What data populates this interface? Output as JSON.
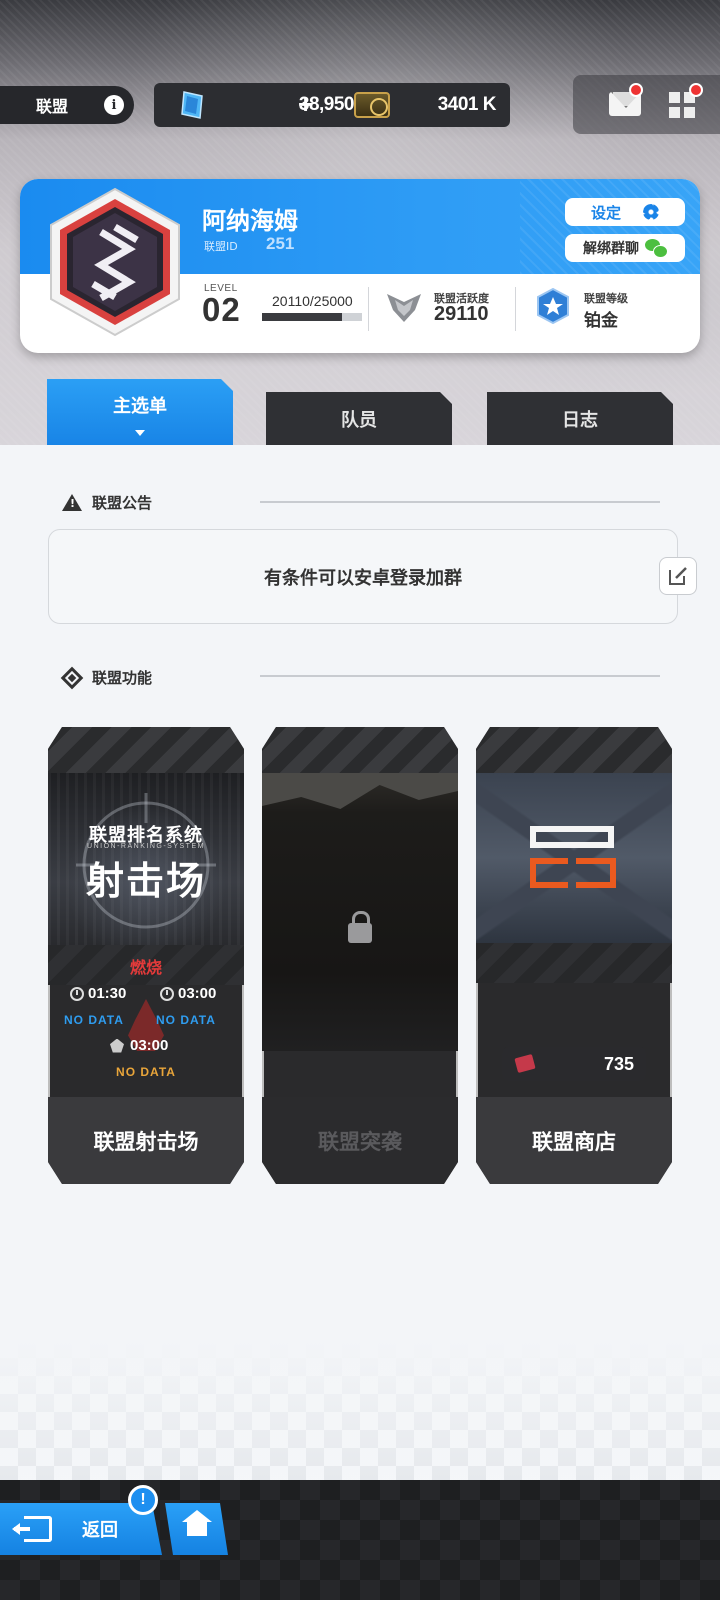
{
  "topbar": {
    "title": "联盟",
    "gem_amount": "38,950",
    "plus": "+",
    "coin_amount": "3401 K"
  },
  "union": {
    "name": "阿纳海姆",
    "id_label": "联盟ID",
    "id": "251",
    "settings_label": "设定",
    "unbind_label": "解绑群聊",
    "level_label": "LEVEL",
    "level": "02",
    "exp_text": "20110/25000",
    "exp_progress": 0.8044,
    "activity_label": "联盟活跃度",
    "activity": "29110",
    "rank_label": "联盟等级",
    "rank": "铂金"
  },
  "tabs": [
    {
      "label": "主选单",
      "active": true
    },
    {
      "label": "队员",
      "active": false
    },
    {
      "label": "日志",
      "active": false
    }
  ],
  "notice": {
    "heading": "联盟公告",
    "text": "有条件可以安卓登录加群"
  },
  "functions": {
    "heading": "联盟功能",
    "range": {
      "art_title_small": "联盟排名系统",
      "art_subtitle": "UNION-RANKING-SYSTEM",
      "art_title_large": "射击场",
      "status": "燃烧",
      "time1": "01:30",
      "time2": "03:00",
      "nodata1": "NO DATA",
      "nodata2": "NO DATA",
      "time3": "03:00",
      "nodata3": "NO DATA",
      "label": "联盟射击场"
    },
    "raid": {
      "label": "联盟突袭",
      "locked": true
    },
    "shop": {
      "currency": "735",
      "label": "联盟商店"
    }
  },
  "bottom": {
    "back_label": "返回",
    "alert": "!"
  },
  "colors": {
    "accent_blue": "#1a8bf0",
    "burn_red": "#e23a3a",
    "nodata_blue": "#2f9df0",
    "nodata_orange": "#e9a53a",
    "badge_red": "#e33333"
  }
}
